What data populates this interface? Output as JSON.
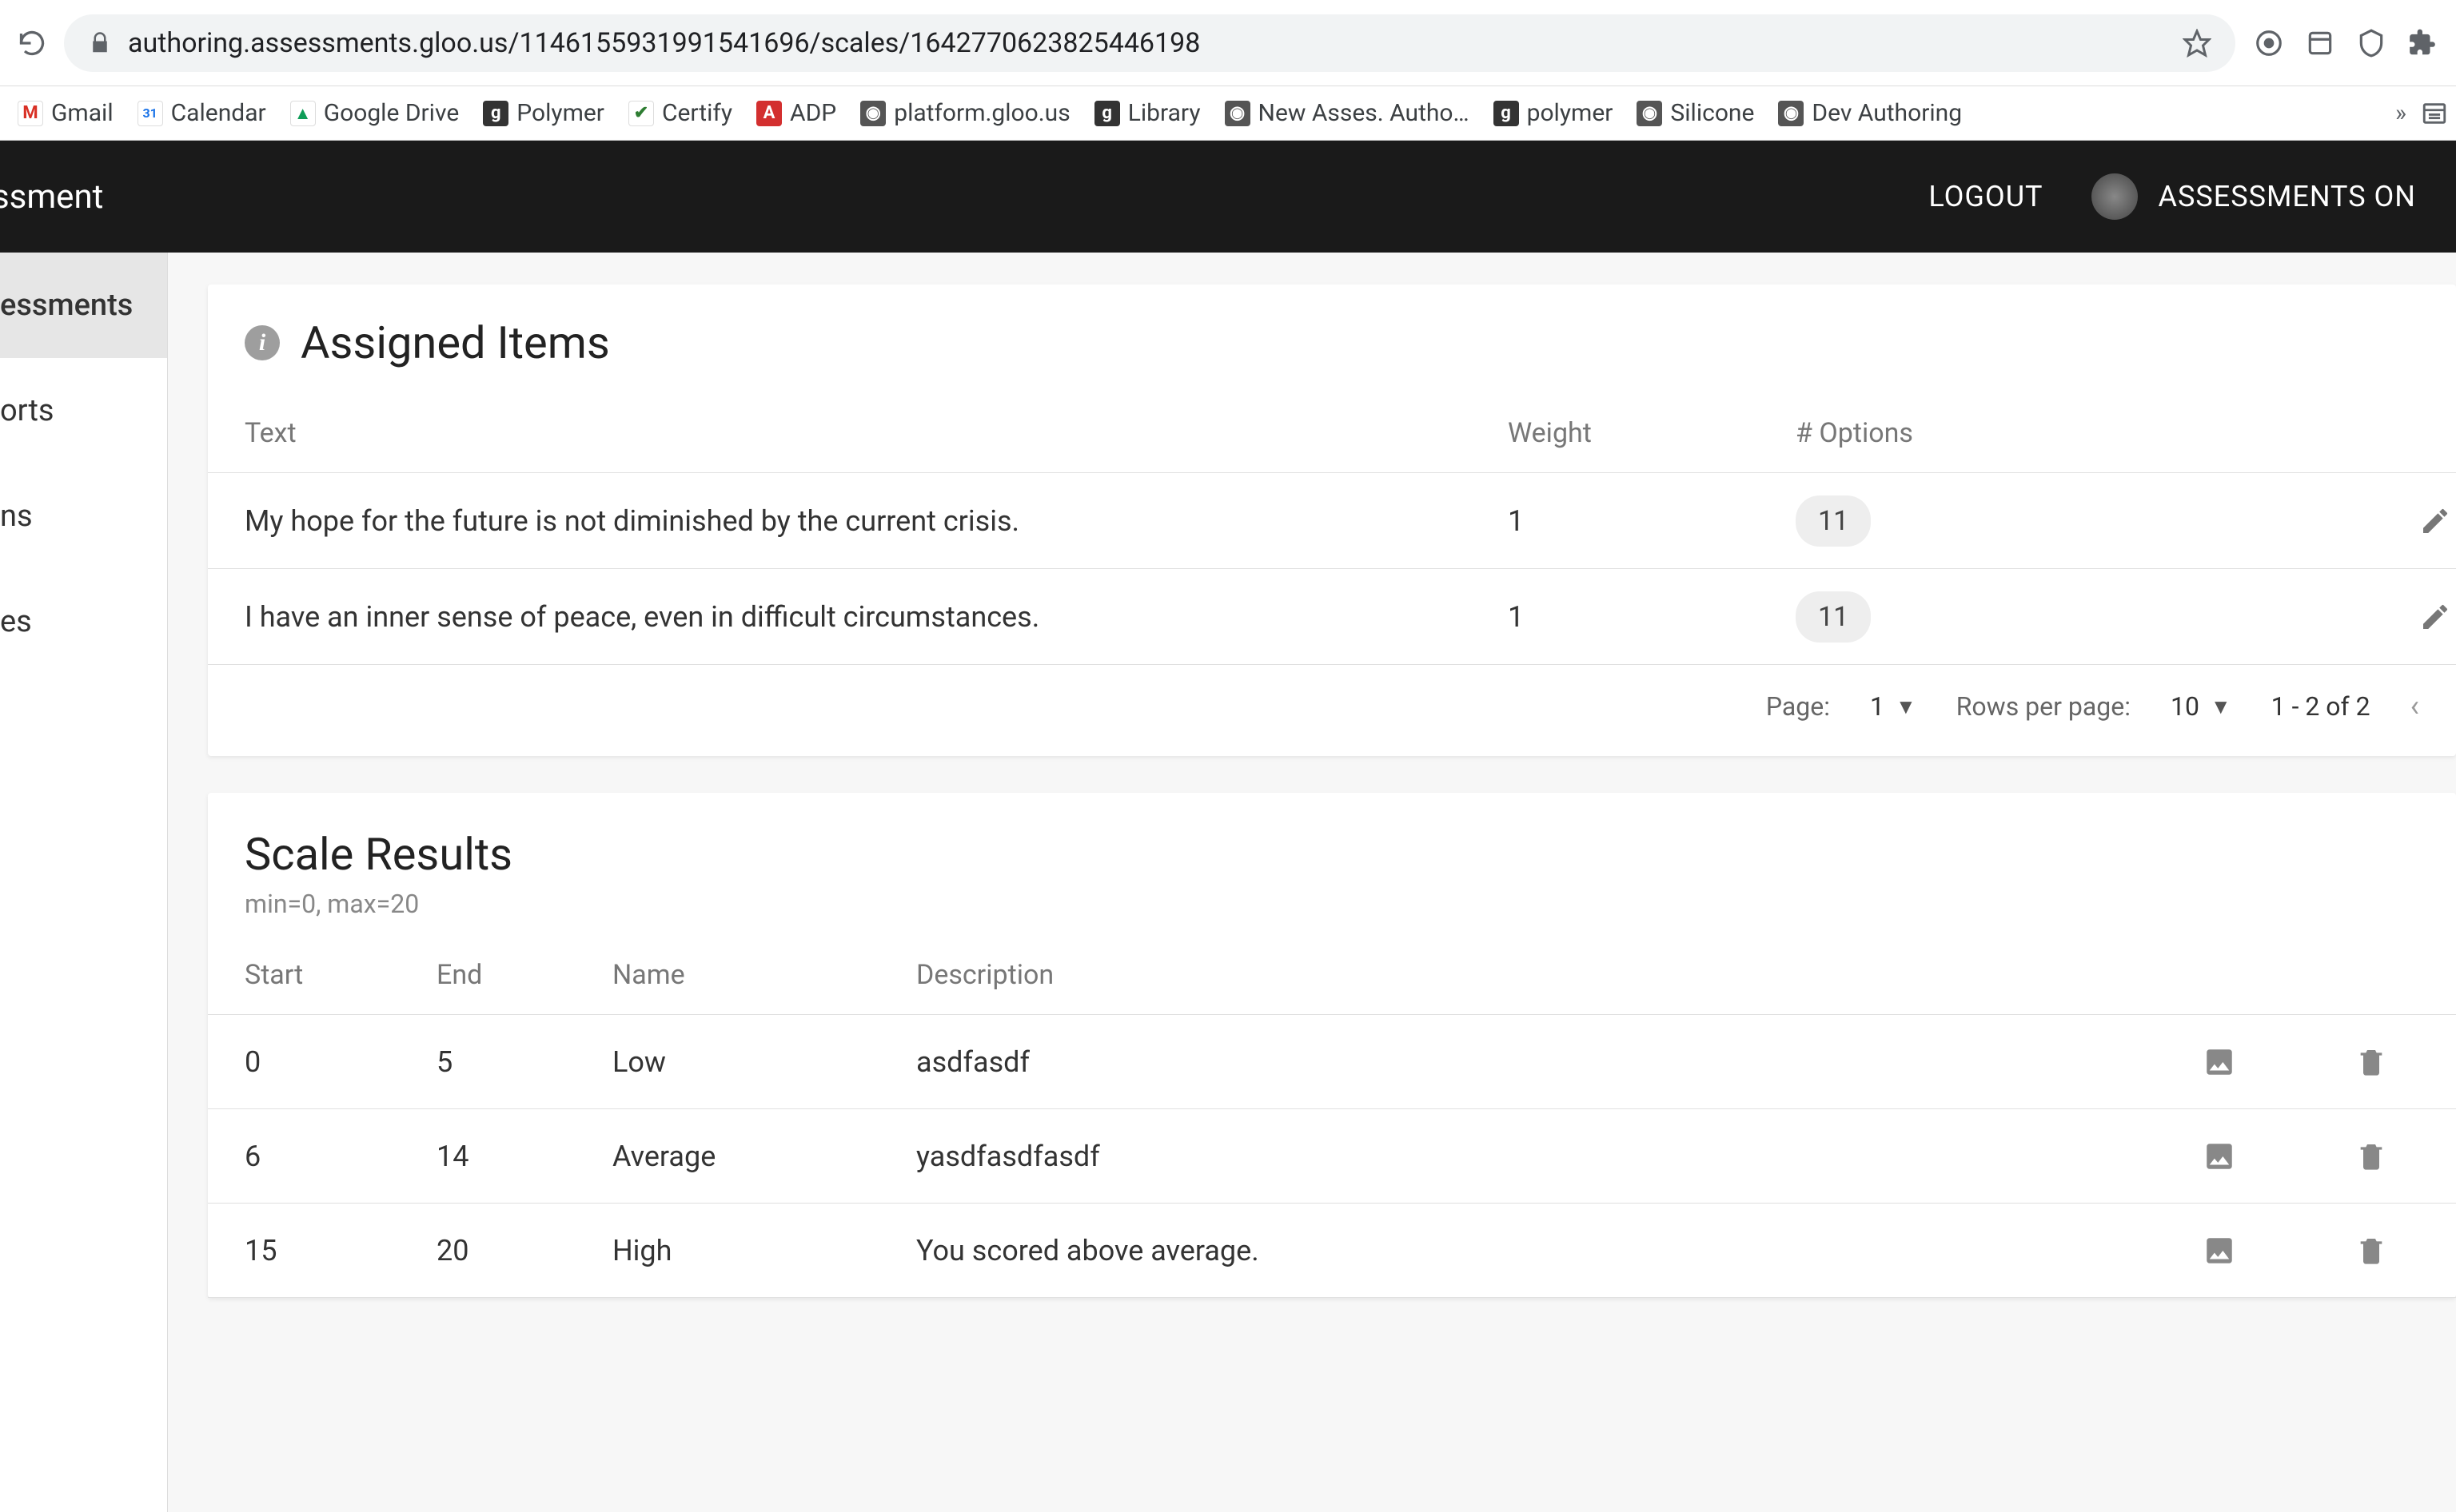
{
  "browser": {
    "url": "authoring.assessments.gloo.us/1146155931991541696/scales/1642770623825446198",
    "bookmarks": [
      {
        "label": "Gmail",
        "favicon_bg": "#ffffff",
        "favicon_fg": "#d93025",
        "glyph": "M"
      },
      {
        "label": "Calendar",
        "favicon_bg": "#ffffff",
        "favicon_fg": "#1a73e8",
        "glyph": "31"
      },
      {
        "label": "Google Drive",
        "favicon_bg": "#ffffff",
        "favicon_fg": "#0f9d58",
        "glyph": "▲"
      },
      {
        "label": "Polymer",
        "favicon_bg": "#333333",
        "favicon_fg": "#ffffff",
        "glyph": "g"
      },
      {
        "label": "Certify",
        "favicon_bg": "#ffffff",
        "favicon_fg": "#2e7d32",
        "glyph": "✔"
      },
      {
        "label": "ADP",
        "favicon_bg": "#d32f2f",
        "favicon_fg": "#ffffff",
        "glyph": "A"
      },
      {
        "label": "platform.gloo.us",
        "favicon_bg": "#555555",
        "favicon_fg": "#ffffff",
        "glyph": "◉"
      },
      {
        "label": "Library",
        "favicon_bg": "#333333",
        "favicon_fg": "#ffffff",
        "glyph": "g"
      },
      {
        "label": "New Asses. Autho…",
        "favicon_bg": "#555555",
        "favicon_fg": "#ffffff",
        "glyph": "◉"
      },
      {
        "label": "polymer",
        "favicon_bg": "#333333",
        "favicon_fg": "#ffffff",
        "glyph": "g"
      },
      {
        "label": "Silicone",
        "favicon_bg": "#555555",
        "favicon_fg": "#ffffff",
        "glyph": "◉"
      },
      {
        "label": "Dev Authoring",
        "favicon_bg": "#555555",
        "favicon_fg": "#ffffff",
        "glyph": "◉"
      }
    ],
    "bookmarks_overflow": "»"
  },
  "header": {
    "app_title": "ssment",
    "logout": "LOGOUT",
    "account": "ASSESSMENTS ON"
  },
  "sidebar": {
    "items": [
      {
        "label": "essments",
        "active": true
      },
      {
        "label": "orts",
        "active": false
      },
      {
        "label": "ns",
        "active": false
      },
      {
        "label": "es",
        "active": false
      }
    ]
  },
  "assigned_items": {
    "title": "Assigned Items",
    "columns": {
      "text": "Text",
      "weight": "Weight",
      "options": "# Options"
    },
    "rows": [
      {
        "text": "My hope for the future is not diminished by the current crisis.",
        "weight": "1",
        "options": "11"
      },
      {
        "text": "I have an inner sense of peace, even in difficult circumstances.",
        "weight": "1",
        "options": "11"
      }
    ],
    "footer": {
      "page_label": "Page:",
      "page_value": "1",
      "rows_label": "Rows per page:",
      "rows_value": "10",
      "range": "1 - 2 of 2"
    }
  },
  "scale_results": {
    "title": "Scale Results",
    "subtitle": "min=0, max=20",
    "columns": {
      "start": "Start",
      "end": "End",
      "name": "Name",
      "description": "Description"
    },
    "rows": [
      {
        "start": "0",
        "end": "5",
        "name": "Low",
        "description": "asdfasdf"
      },
      {
        "start": "6",
        "end": "14",
        "name": "Average",
        "description": "yasdfasdfasdf"
      },
      {
        "start": "15",
        "end": "20",
        "name": "High",
        "description": "You scored above average."
      }
    ]
  }
}
